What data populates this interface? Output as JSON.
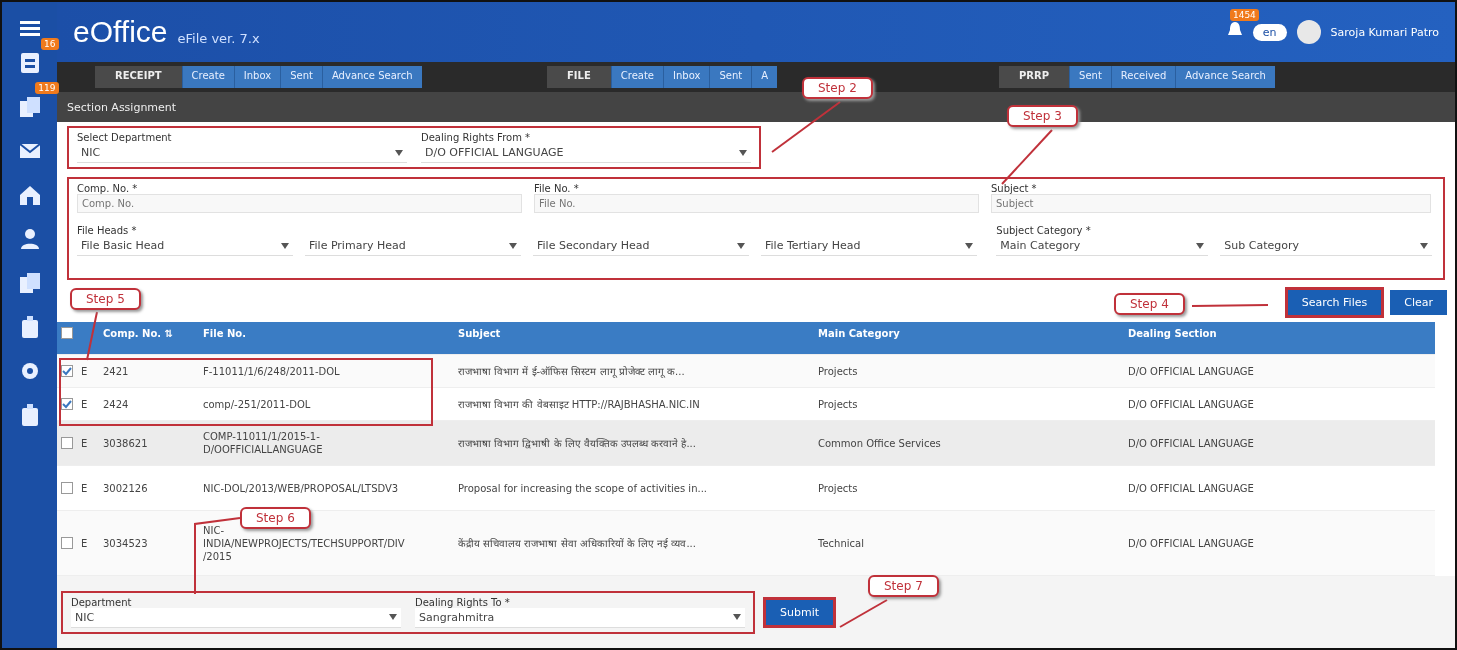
{
  "header": {
    "logo": "eOffice",
    "product": "eFile ver. 7.x",
    "notification_count": "1454",
    "language": "en",
    "user_name": "Saroja Kumari Patro"
  },
  "sidebar": {
    "items": [
      {
        "kind": "document",
        "badge": "16"
      },
      {
        "kind": "files",
        "badge": "119"
      },
      {
        "kind": "mail"
      },
      {
        "kind": "home"
      },
      {
        "kind": "person"
      },
      {
        "kind": "files"
      },
      {
        "kind": "bag"
      },
      {
        "kind": "gear"
      },
      {
        "kind": "bag"
      }
    ]
  },
  "nav_groups": [
    {
      "title": "RECEIPT",
      "items": [
        "Create",
        "Inbox",
        "Sent",
        "Advance Search"
      ]
    },
    {
      "title": "FILE",
      "items": [
        "Create",
        "Inbox",
        "Sent",
        "A"
      ]
    },
    {
      "title": "PRRP",
      "items": [
        "Sent",
        "Received",
        "Advance Search"
      ]
    }
  ],
  "section_title": "Section Assignment",
  "from_form": {
    "department_label": "Select Department",
    "department_value": "NIC",
    "rights_label": "Dealing Rights From *",
    "rights_value": "D/O OFFICIAL LANGUAGE"
  },
  "search_form": {
    "fields": [
      {
        "label": "Comp. No. *",
        "placeholder": "Comp. No."
      },
      {
        "label": "File No. *",
        "placeholder": "File No."
      },
      {
        "label": "Subject *",
        "placeholder": "Subject"
      }
    ],
    "heads_label": "File Heads *",
    "heads": [
      "File Basic Head",
      "File Primary Head",
      "File Secondary Head",
      "File Tertiary Head"
    ],
    "category_label": "Subject Category *",
    "categories": [
      "Main Category",
      "Sub Category"
    ]
  },
  "buttons": [
    "Search Files",
    "Clear"
  ],
  "table": {
    "all_checked": false,
    "columns": [
      "Comp. No.",
      "File No.",
      "Subject",
      "Main Category",
      "Dealing Section"
    ],
    "sort_icon": "⇅",
    "rows": [
      {
        "checked": true,
        "type": "E",
        "comp": "2421",
        "file": "F-11011/1/6/248/2011-DOL",
        "subject": "राजभाषा विभाग में ई-ऑफिस सिस्टम लागू प्रोजेक्ट लागू क...",
        "category": "Projects",
        "section": "D/O OFFICIAL LANGUAGE"
      },
      {
        "checked": true,
        "type": "E",
        "comp": "2424",
        "file": "comp/-251/2011-DOL",
        "subject": "राजभाषा विभाग की वेबसाइट HTTP://RAJBHASHA.NIC.IN",
        "category": "Projects",
        "section": "D/O OFFICIAL LANGUAGE"
      },
      {
        "checked": false,
        "type": "E",
        "comp": "3038621",
        "file": "COMP-11011/1/2015-1-D/OOFFICIALLANGUAGE",
        "subject": "राजभाषा विभाग द्विभाषी के लिए वैयक्तिक उपलब्ध करवाने हे...",
        "category": "Common Office Services",
        "section": "D/O OFFICIAL LANGUAGE"
      },
      {
        "checked": false,
        "type": "E",
        "comp": "3002126",
        "file": "NIC-DOL/2013/WEB/PROPOSAL/LTSDV3",
        "subject": "Proposal for increasing the scope of activities in...",
        "category": "Projects",
        "section": "D/O OFFICIAL LANGUAGE"
      },
      {
        "checked": false,
        "type": "E",
        "comp": "3034523",
        "file": "NIC-INDIA/NEWPROJECTS/TECHSUPPORT/DIV/2015",
        "subject": "केंद्रीय सचिवालय राजभाषा सेवा अधिकारियों के लिए नई व्यव...",
        "category": "Technical",
        "section": "D/O OFFICIAL LANGUAGE"
      }
    ]
  },
  "to_form": {
    "department_label": "Department",
    "department_value": "NIC",
    "rights_label": "Dealing Rights To *",
    "rights_value": "Sangrahmitra",
    "submit": "Submit"
  },
  "callouts": [
    "Step 2",
    "Step 3",
    "Step 5",
    "Step 4",
    "Step 6",
    "Step 7"
  ]
}
